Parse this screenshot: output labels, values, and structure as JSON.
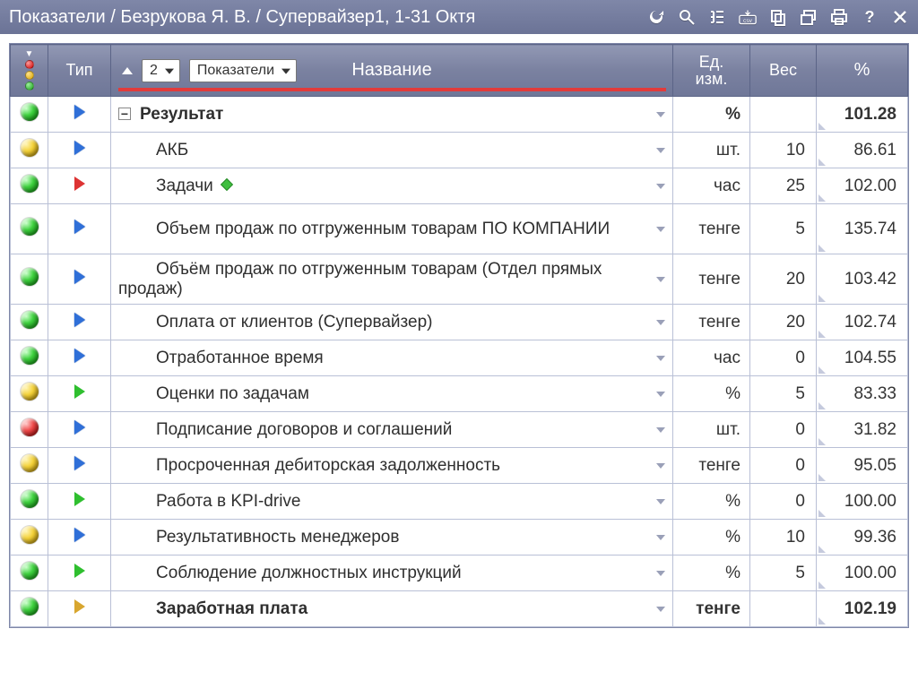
{
  "titlebar": {
    "title": "Показатели / Безрукова Я. В. / Супервайзер1, 1-31 Октя"
  },
  "header": {
    "type": "Тип",
    "level_value": "2",
    "view_select": "Показатели",
    "name": "Название",
    "unit_line1": "Ед.",
    "unit_line2": "изм.",
    "weight": "Вес",
    "percent": "%"
  },
  "status_colors": {
    "green": "orb-green",
    "yellow": "orb-yellow",
    "red": "orb-red"
  },
  "type_colors": {
    "blue": "tri-blue",
    "green": "tri-green",
    "red": "tri-red",
    "gold": "tri-gold"
  },
  "rows": [
    {
      "status": "green",
      "type": "blue",
      "bold": true,
      "collapse": true,
      "name": "Результат",
      "unit": "%",
      "weight": "",
      "pct": "101.28"
    },
    {
      "status": "yellow",
      "type": "blue",
      "name": "АКБ",
      "unit": "шт.",
      "weight": "10",
      "pct": "86.61"
    },
    {
      "status": "green",
      "type": "red",
      "name": "Задачи",
      "diamond": true,
      "unit": "час",
      "weight": "25",
      "pct": "102.00"
    },
    {
      "status": "green",
      "type": "blue",
      "tall": true,
      "name": "Объем продаж по отгруженным товарам ПО КОМПАНИИ",
      "unit": "тенге",
      "weight": "5",
      "pct": "135.74"
    },
    {
      "status": "green",
      "type": "blue",
      "tall": true,
      "name": "Объём продаж по отгруженным товарам (Отдел прямых продаж)",
      "unit": "тенге",
      "weight": "20",
      "pct": "103.42"
    },
    {
      "status": "green",
      "type": "blue",
      "name": "Оплата от клиентов (Супервайзер)",
      "unit": "тенге",
      "weight": "20",
      "pct": "102.74"
    },
    {
      "status": "green",
      "type": "blue",
      "name": "Отработанное время",
      "unit": "час",
      "weight": "0",
      "pct": "104.55"
    },
    {
      "status": "yellow",
      "type": "green",
      "name": "Оценки по задачам",
      "unit": "%",
      "weight": "5",
      "pct": "83.33"
    },
    {
      "status": "red",
      "type": "blue",
      "name": "Подписание договоров и соглашений",
      "unit": "шт.",
      "weight": "0",
      "pct": "31.82"
    },
    {
      "status": "yellow",
      "type": "blue",
      "name": "Просроченная дебиторская задолженность",
      "unit": "тенге",
      "weight": "0",
      "pct": "95.05"
    },
    {
      "status": "green",
      "type": "green",
      "name": "Работа в KPI-drive",
      "unit": "%",
      "weight": "0",
      "pct": "100.00"
    },
    {
      "status": "yellow",
      "type": "blue",
      "name": "Результативность менеджеров",
      "unit": "%",
      "weight": "10",
      "pct": "99.36"
    },
    {
      "status": "green",
      "type": "green",
      "name": "Соблюдение должностных инструкций",
      "unit": "%",
      "weight": "5",
      "pct": "100.00"
    },
    {
      "status": "green",
      "type": "gold",
      "bold": true,
      "name": "Заработная плата",
      "unit": "тенге",
      "weight": "",
      "pct": "102.19"
    }
  ]
}
